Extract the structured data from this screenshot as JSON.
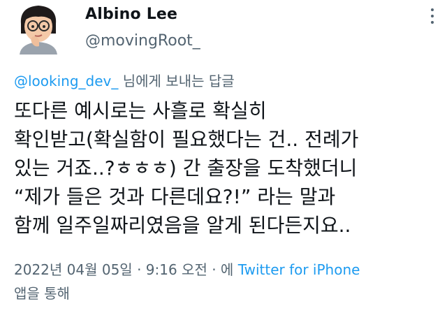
{
  "author": {
    "name": "Albino Lee",
    "handle": "@movingRoot_"
  },
  "reply": {
    "mention": "@looking_dev_",
    "suffix": " 님에게 보내는 답글"
  },
  "tweet": {
    "lines": [
      "또다른 예시로는 사흘로 확실히",
      "확인받고(확실함이 필요했다는 건.. 전례가",
      "있는 거죠..?ㅎㅎㅎ) 간 출장을 도착했더니",
      "“제가 들은 것과 다른데요?!” 라는 말과",
      "함께 일주일짜리였음을 알게 된다든지요.."
    ]
  },
  "meta": {
    "timestamp": "2022년 04월 05일 · 9:16 오전 · 에 ",
    "source": "Twitter for iPhone",
    "source_suffix": "앱을 통해"
  },
  "icons": {
    "avatar": "memoji-thinking-avatar",
    "more": "more-options-icon"
  },
  "colors": {
    "link": "#1d9bf0",
    "secondary": "#536471",
    "text": "#0f1419"
  }
}
